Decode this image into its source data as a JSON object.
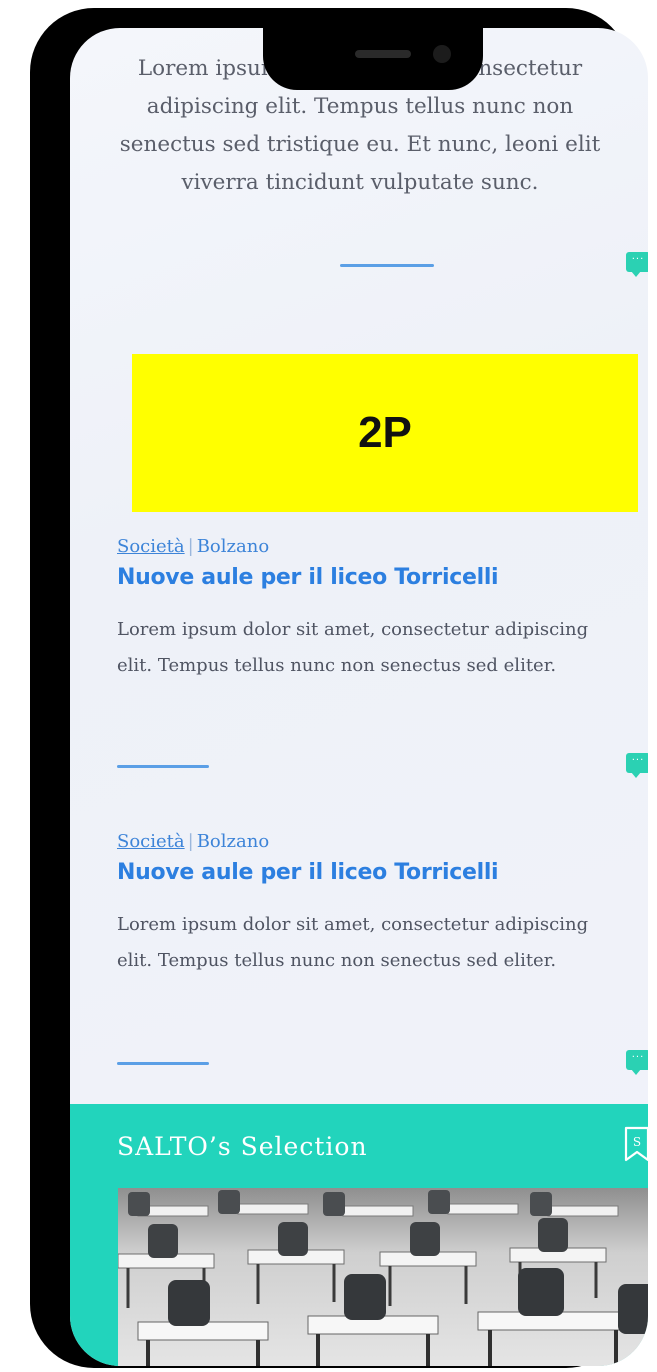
{
  "intro": {
    "text": "Lorem ipsum dolor sit amet, consectetur adipiscing elit. Tempus tellus nunc non senectus sed tristique eu. Et nunc, leoni elit viverra tincidunt vulputate sunc."
  },
  "ad": {
    "label": "2P"
  },
  "articles": [
    {
      "category": "Società",
      "location": "Bolzano",
      "separator": "|",
      "title": "Nuove aule per il liceo Torricelli",
      "excerpt": "Lorem ipsum dolor sit amet, consectetur adipiscing elit. Tempus tellus nunc non senectus sed eliter."
    },
    {
      "category": "Società",
      "location": "Bolzano",
      "separator": "|",
      "title": "Nuove aule per il liceo Torricelli",
      "excerpt": "Lorem ipsum dolor sit amet, consectetur adipiscing elit. Tempus tellus nunc non senectus sed eliter."
    }
  ],
  "selection": {
    "title": "SALTO’s Selection",
    "bookmark_letter": "S"
  },
  "icons": {
    "comment": "comment-icon",
    "bookmark": "bookmark-icon"
  },
  "colors": {
    "accent_teal": "#22d4bc",
    "link_blue": "#2c7fe0",
    "ad_yellow": "#ffff00"
  }
}
